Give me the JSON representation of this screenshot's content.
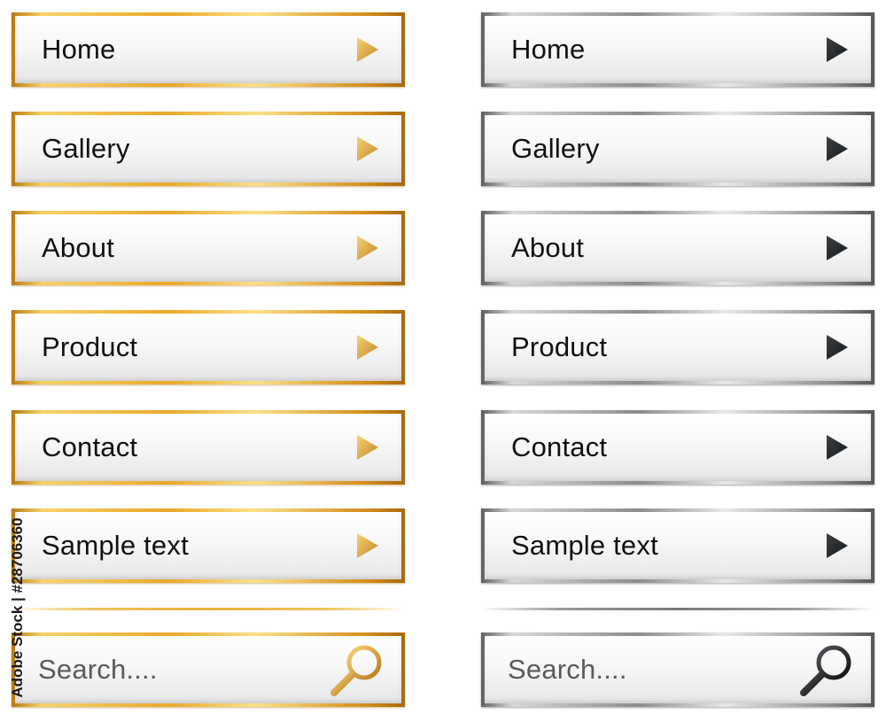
{
  "menu_items": [
    "Home",
    "Gallery",
    "About",
    "Product",
    "Contact",
    "Sample text"
  ],
  "search": {
    "placeholder": "Search...."
  },
  "themes": {
    "gold": {
      "frame_color": "#e9a82a",
      "arrow_color": "#d9a23a"
    },
    "silver": {
      "frame_color": "#8c8c8c",
      "arrow_color": "#2b2f33"
    }
  },
  "icons": {
    "arrow": "play-arrow-icon",
    "search": "magnifier-icon"
  },
  "stock_id": "Adobe Stock | #28706360"
}
